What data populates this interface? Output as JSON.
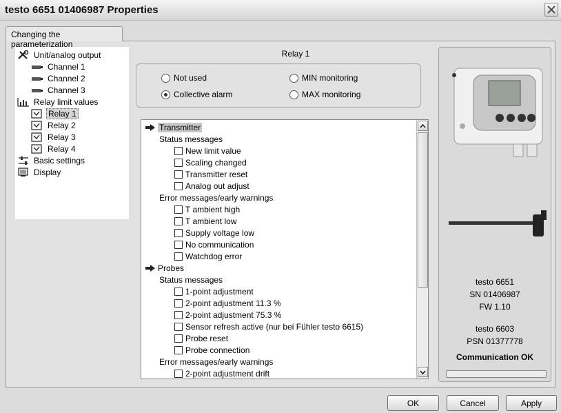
{
  "window": {
    "title": "testo 6651  01406987 Properties",
    "close_icon": "close-icon"
  },
  "tab": {
    "label": "Changing the parameterization"
  },
  "tree": {
    "unit_analog_output": "Unit/analog output",
    "channel_1": "Channel 1",
    "channel_2": "Channel 2",
    "channel_3": "Channel 3",
    "relay_limit_values": "Relay limit values",
    "relay_1": "Relay 1",
    "relay_2": "Relay 2",
    "relay_3": "Relay 3",
    "relay_4": "Relay 4",
    "basic_settings": "Basic settings",
    "display": "Display",
    "selected": "Relay 1"
  },
  "relay": {
    "title": "Relay 1",
    "options": {
      "not_used": "Not used",
      "collective_alarm": "Collective alarm",
      "min_monitoring": "MIN monitoring",
      "max_monitoring": "MAX monitoring"
    },
    "selected_option": "Collective alarm"
  },
  "list": {
    "transmitter": "Transmitter",
    "t_status": "Status messages",
    "new_limit": "New limit value",
    "scaling": "Scaling changed",
    "reset": "Transmitter reset",
    "analog_adjust": "Analog out adjust",
    "t_errors": "Error messages/early warnings",
    "t_ambient_high": "T ambient high",
    "t_ambient_low": "T ambient low",
    "supply_low": "Supply voltage low",
    "no_comm": "No communication",
    "watchdog": "Watchdog error",
    "probes": "Probes",
    "p_status": "Status messages",
    "one_point": "1-point adjustment",
    "two_point_113": "2-point adjustment 11.3 %",
    "two_point_753": "2-point adjustment 75.3 %",
    "sensor_refresh": "Sensor refresh active (nur bei Fühler testo 6615)",
    "probe_reset": "Probe reset",
    "probe_conn": "Probe connection",
    "p_errors": "Error messages/early warnings",
    "two_point_drift": "2-point adjustment drift"
  },
  "device": {
    "model": "testo 6651",
    "sn": "SN 01406987",
    "fw": "FW  1.10",
    "probe_model": "testo 6603",
    "psn": "PSN 01377778",
    "status": "Communication OK"
  },
  "buttons": {
    "ok": "OK",
    "cancel": "Cancel",
    "apply": "Apply"
  }
}
